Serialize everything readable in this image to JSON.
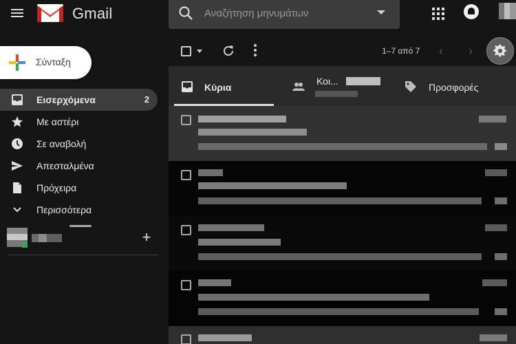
{
  "app": {
    "brand": "Gmail",
    "icons": {
      "menu": "menu-icon",
      "logo": "gmail-logo",
      "apps": "apps-grid-icon",
      "notifications": "notifications-icon"
    }
  },
  "search": {
    "placeholder": "Αναζήτηση μηνυμάτων",
    "icon": "search-icon",
    "options_icon": "caret-down-icon"
  },
  "compose": {
    "label": "Σύνταξη"
  },
  "sidebar": {
    "items": [
      {
        "label": "Εισερχόμενα",
        "count": "2",
        "icon": "inbox-icon",
        "active": true
      },
      {
        "label": "Με αστέρι",
        "icon": "star-icon"
      },
      {
        "label": "Σε αναβολή",
        "icon": "clock-icon"
      },
      {
        "label": "Απεσταλμένα",
        "icon": "send-icon"
      },
      {
        "label": "Πρόχειρα",
        "icon": "draft-icon"
      },
      {
        "label": "Περισσότερα",
        "icon": "chevron-down-icon"
      }
    ],
    "hangouts": {
      "add": "+"
    }
  },
  "toolbar": {
    "range": "1–7 από 7",
    "prev": "‹",
    "next": "›"
  },
  "tabs": [
    {
      "label": "Κύρια",
      "icon": "inbox-tab-icon",
      "active": true
    },
    {
      "label": "Κοι...",
      "icon": "people-icon"
    },
    {
      "label": "Προσφορές",
      "icon": "tag-icon"
    }
  ],
  "colors": {
    "background": "#151515",
    "search_bg": "#3c3c3c",
    "selected_row": "#323232",
    "active_nav": "#3d3d3d",
    "online_dot": "#34a853"
  }
}
